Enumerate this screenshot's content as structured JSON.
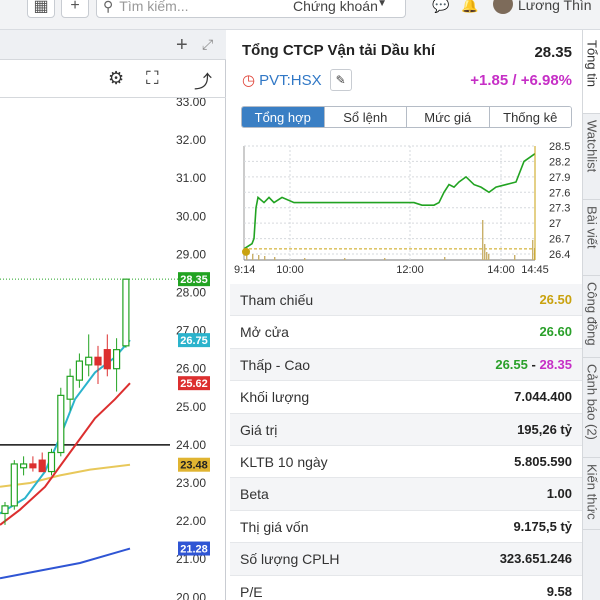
{
  "topbar": {
    "search_placeholder": "Tìm kiếm...",
    "exchange_select": "Chứng khoán",
    "user_name": "Lương Thìn"
  },
  "left_chart": {
    "price_axis": [
      "33.00",
      "32.00",
      "31.00",
      "30.00",
      "29.00",
      "28.00",
      "27.00",
      "26.00",
      "25.00",
      "24.00",
      "23.00",
      "22.00",
      "21.00",
      "20.00"
    ],
    "markers": [
      {
        "label": "28.35",
        "color": "#22a322",
        "value": 28.35
      },
      {
        "label": "26.75",
        "color": "#2bb3cc",
        "value": 26.75
      },
      {
        "label": "25.62",
        "color": "#dc2f2f",
        "value": 25.62
      },
      {
        "label": "23.48",
        "color": "#e0b431",
        "value": 23.48
      },
      {
        "label": "21.28",
        "color": "#2f55d4",
        "value": 21.28
      }
    ],
    "candles": [
      {
        "o": 22.2,
        "h": 22.5,
        "l": 21.9,
        "c": 22.4
      },
      {
        "o": 22.4,
        "h": 23.6,
        "l": 22.3,
        "c": 23.5
      },
      {
        "o": 23.4,
        "h": 23.7,
        "l": 23.2,
        "c": 23.5
      },
      {
        "o": 23.5,
        "h": 23.7,
        "l": 23.3,
        "c": 23.4
      },
      {
        "o": 23.6,
        "h": 23.8,
        "l": 23.3,
        "c": 23.3
      },
      {
        "o": 23.3,
        "h": 23.9,
        "l": 23.2,
        "c": 23.8
      },
      {
        "o": 23.8,
        "h": 25.5,
        "l": 23.7,
        "c": 25.3
      },
      {
        "o": 25.2,
        "h": 26.0,
        "l": 24.9,
        "c": 25.8
      },
      {
        "o": 25.7,
        "h": 26.4,
        "l": 25.5,
        "c": 26.2
      },
      {
        "o": 26.1,
        "h": 26.9,
        "l": 25.8,
        "c": 26.3
      },
      {
        "o": 26.3,
        "h": 26.6,
        "l": 25.6,
        "c": 26.1
      },
      {
        "o": 26.5,
        "h": 26.9,
        "l": 25.8,
        "c": 26.0
      },
      {
        "o": 26.0,
        "h": 26.8,
        "l": 25.4,
        "c": 26.5
      },
      {
        "o": 26.6,
        "h": 28.35,
        "l": 26.55,
        "c": 28.35
      }
    ],
    "reference_line": 24.0
  },
  "stock": {
    "company": "Tổng CTCP Vận tải Dầu khí",
    "price": "28.35",
    "ticker": "PVT:HSX",
    "change": "+1.85 / +6.98%",
    "tabs": [
      "Tổng hợp",
      "Sổ lệnh",
      "Mức giá",
      "Thống kê"
    ]
  },
  "chart_data": {
    "type": "line",
    "title": "",
    "x_ticks": [
      "9:14",
      "10:00",
      "12:00",
      "14:00",
      "14:45"
    ],
    "y_ticks": [
      "28.5",
      "28.2",
      "27.9",
      "27.6",
      "27.3",
      "27",
      "26.7",
      "26.4"
    ],
    "ylim": [
      26.4,
      28.5
    ],
    "reference": 26.5,
    "series": [
      {
        "x": [
          0,
          8,
          10,
          12,
          14,
          20,
          25,
          30,
          38,
          50,
          80,
          120,
          170,
          178,
          190,
          195,
          200,
          205,
          210,
          215,
          222,
          230,
          237,
          245,
          252,
          262,
          272,
          280,
          291
        ],
        "y": [
          26.5,
          26.6,
          26.7,
          27.3,
          27.5,
          27.4,
          27.5,
          27.4,
          27.5,
          27.4,
          27.4,
          27.4,
          27.4,
          27.35,
          27.35,
          27.4,
          27.6,
          27.75,
          27.7,
          27.8,
          27.9,
          27.75,
          27.7,
          27.6,
          27.7,
          27.75,
          27.8,
          28.2,
          28.35
        ]
      }
    ]
  },
  "stats": [
    {
      "label": "Tham chiếu",
      "value": "26.50",
      "style": "ref"
    },
    {
      "label": "Mở cửa",
      "value": "26.60",
      "style": "up"
    },
    {
      "label": "Thấp - Cao",
      "low": "26.55",
      "sep": " - ",
      "high": "28.35",
      "style": "range"
    },
    {
      "label": "Khối lượng",
      "value": "7.044.400"
    },
    {
      "label": "Giá trị",
      "value": "195,26 tỷ"
    },
    {
      "label": "KLTB 10 ngày",
      "value": "5.805.590"
    },
    {
      "label": "Beta",
      "value": "1.00"
    },
    {
      "label": "Thị giá vốn",
      "value": "9.175,5 tỷ"
    },
    {
      "label": "Số lượng CPLH",
      "value": "323.651.246"
    },
    {
      "label": "P/E",
      "value": "9.58"
    }
  ],
  "sidebar_tabs": [
    "Tổng tin",
    "Watchlist",
    "Bài viết",
    "Công đồng",
    "Cảnh báo (2)",
    "Kiến thức"
  ]
}
